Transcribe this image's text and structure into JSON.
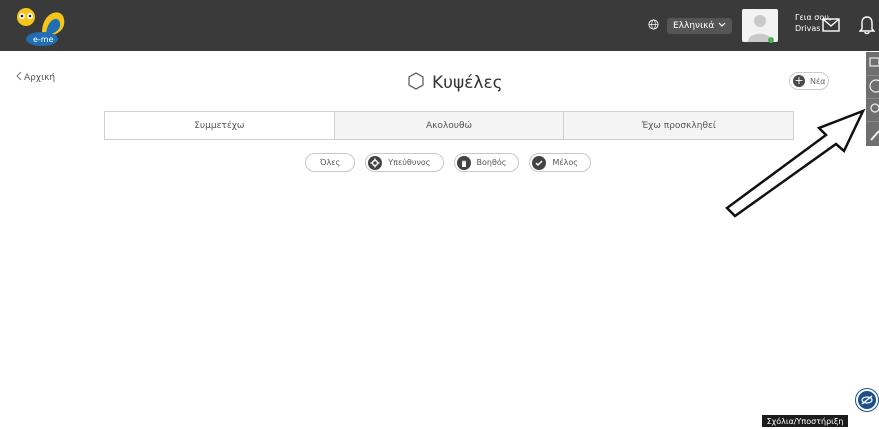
{
  "header": {
    "logo_text": "e-me",
    "language": "Ελληνικά",
    "greeting_line1": "Γεια σου,",
    "greeting_line2": "Drivas"
  },
  "page": {
    "back_label": "Αρχική",
    "title": "Κυψέλες",
    "new_label": "Νέα"
  },
  "tabs": [
    {
      "label": "Συμμετέχω",
      "active": true
    },
    {
      "label": "Ακολουθώ",
      "active": false
    },
    {
      "label": "Έχω προσκληθεί",
      "active": false
    }
  ],
  "filters": {
    "all": "Όλες",
    "manager": "Υπεύθυνος",
    "assistant": "Βοηθός",
    "member": "Μέλος"
  },
  "footer": {
    "feedback_label": "Σχόλια/Υποστήριξη"
  },
  "colors": {
    "topbar": "#3a3a3a",
    "logo_yellow": "#f5c518",
    "logo_blue": "#1f6fb2",
    "accessibility_blue": "#1d4f8f"
  },
  "icons": [
    "globe-icon",
    "chevron-down-icon",
    "mail-icon",
    "bell-icon",
    "hexagon-icon",
    "plus-icon",
    "gear-icon",
    "hand-icon",
    "check-icon",
    "eye-slash-icon"
  ]
}
